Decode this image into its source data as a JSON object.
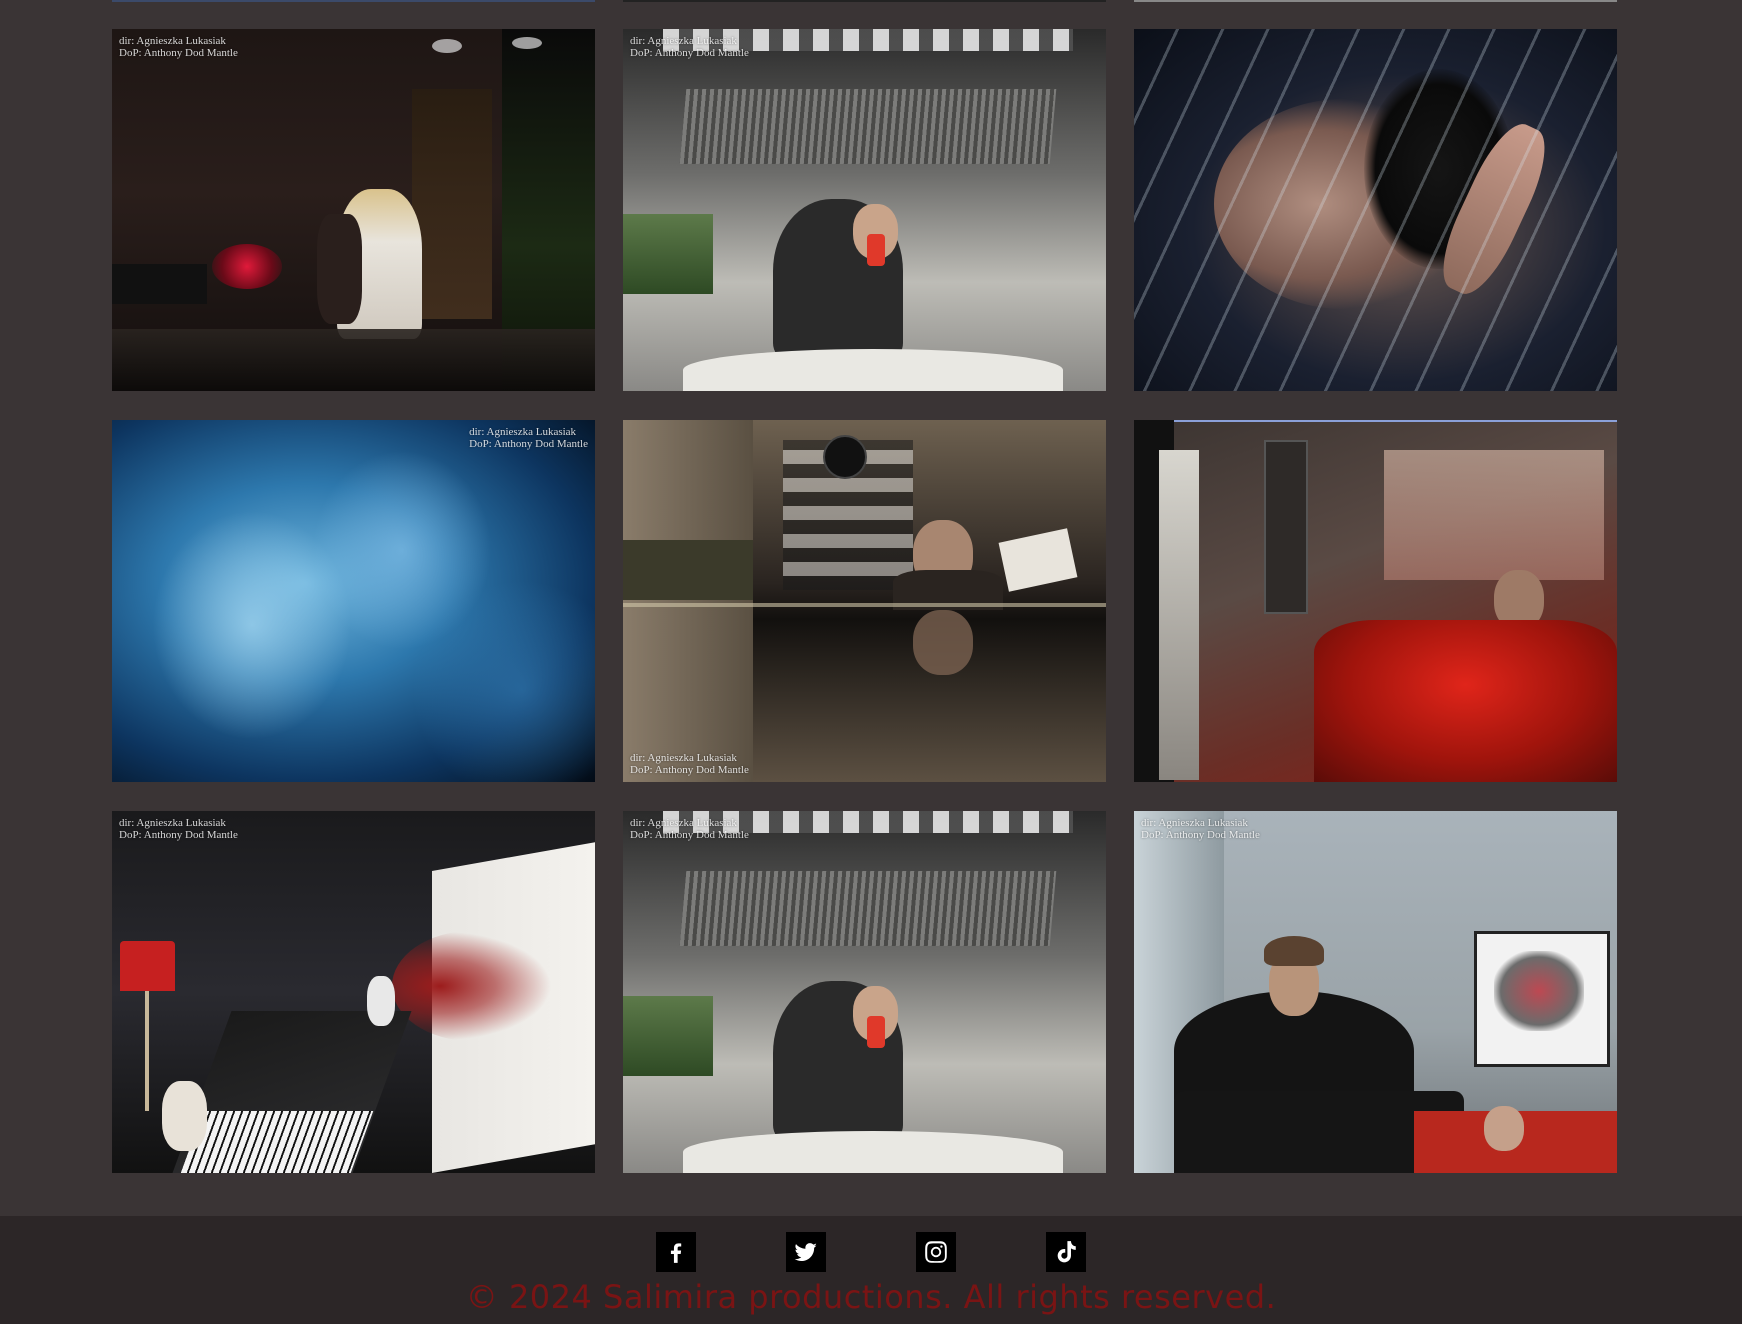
{
  "gallery": {
    "tiles": [
      {
        "name": "still-01",
        "caption_lines": [
          "dir: Agnieszka Lukasiak",
          "DoP: Anthony Dod Mantle"
        ]
      },
      {
        "name": "still-02",
        "caption_lines": [
          "dir: Agnieszka Lukasiak",
          "DoP: Anthony Dod Mantle"
        ]
      },
      {
        "name": "still-03",
        "caption_lines": []
      },
      {
        "name": "still-04",
        "caption_lines": [
          "dir: Agnieszka Lukasiak",
          "DoP: Anthony Dod Mantle"
        ]
      },
      {
        "name": "still-05",
        "caption_lines": [
          "dir: Agnieszka Lukasiak",
          "DoP: Anthony Dod Mantle"
        ]
      },
      {
        "name": "still-06",
        "caption_lines": []
      },
      {
        "name": "still-07",
        "caption_lines": [
          "dir: Agnieszka Lukasiak",
          "DoP: Anthony Dod Mantle"
        ]
      },
      {
        "name": "still-08",
        "caption_lines": [
          "dir: Agnieszka Lukasiak",
          "DoP: Anthony Dod Mantle"
        ]
      },
      {
        "name": "still-09",
        "caption_lines": [
          "dir: Agnieszka Lukasiak",
          "DoP: Anthony Dod Mantle"
        ]
      }
    ]
  },
  "footer": {
    "social_icons": [
      "facebook-icon",
      "twitter-icon",
      "instagram-icon",
      "tiktok-icon"
    ],
    "copyright": "© 2024 Salimira productions. All rights reserved."
  },
  "colors": {
    "page_background": "#3a3435",
    "footer_background": "#2c2627",
    "copyright_text": "#7a1414"
  }
}
